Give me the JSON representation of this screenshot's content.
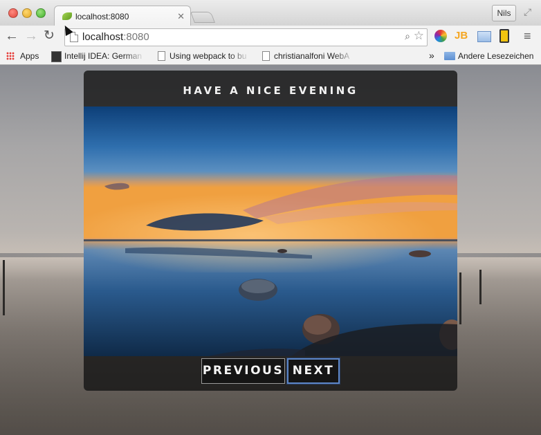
{
  "window": {
    "tab_title": "localhost:8080",
    "profile_name": "Nils"
  },
  "toolbar": {
    "url_host": "localhost",
    "url_port": ":8080"
  },
  "bookmarks": {
    "apps_label": "Apps",
    "items": [
      "Intellij IDEA: German",
      "Using webpack to bu",
      "christianalfoni WebA"
    ],
    "overflow_label": "»",
    "other_label": "Andere Lesezeichen"
  },
  "slideshow": {
    "title": "HAVE A NICE EVENING",
    "previous_label": "PREVIOUS",
    "next_label": "NEXT"
  },
  "colors": {
    "next_focus_border": "#5d86c6",
    "card_background": "#161616"
  },
  "icons": {
    "back": "back-arrow-icon",
    "forward": "forward-arrow-icon",
    "reload": "reload-icon",
    "star": "bookmark-star-icon",
    "menu": "hamburger-menu-icon"
  }
}
